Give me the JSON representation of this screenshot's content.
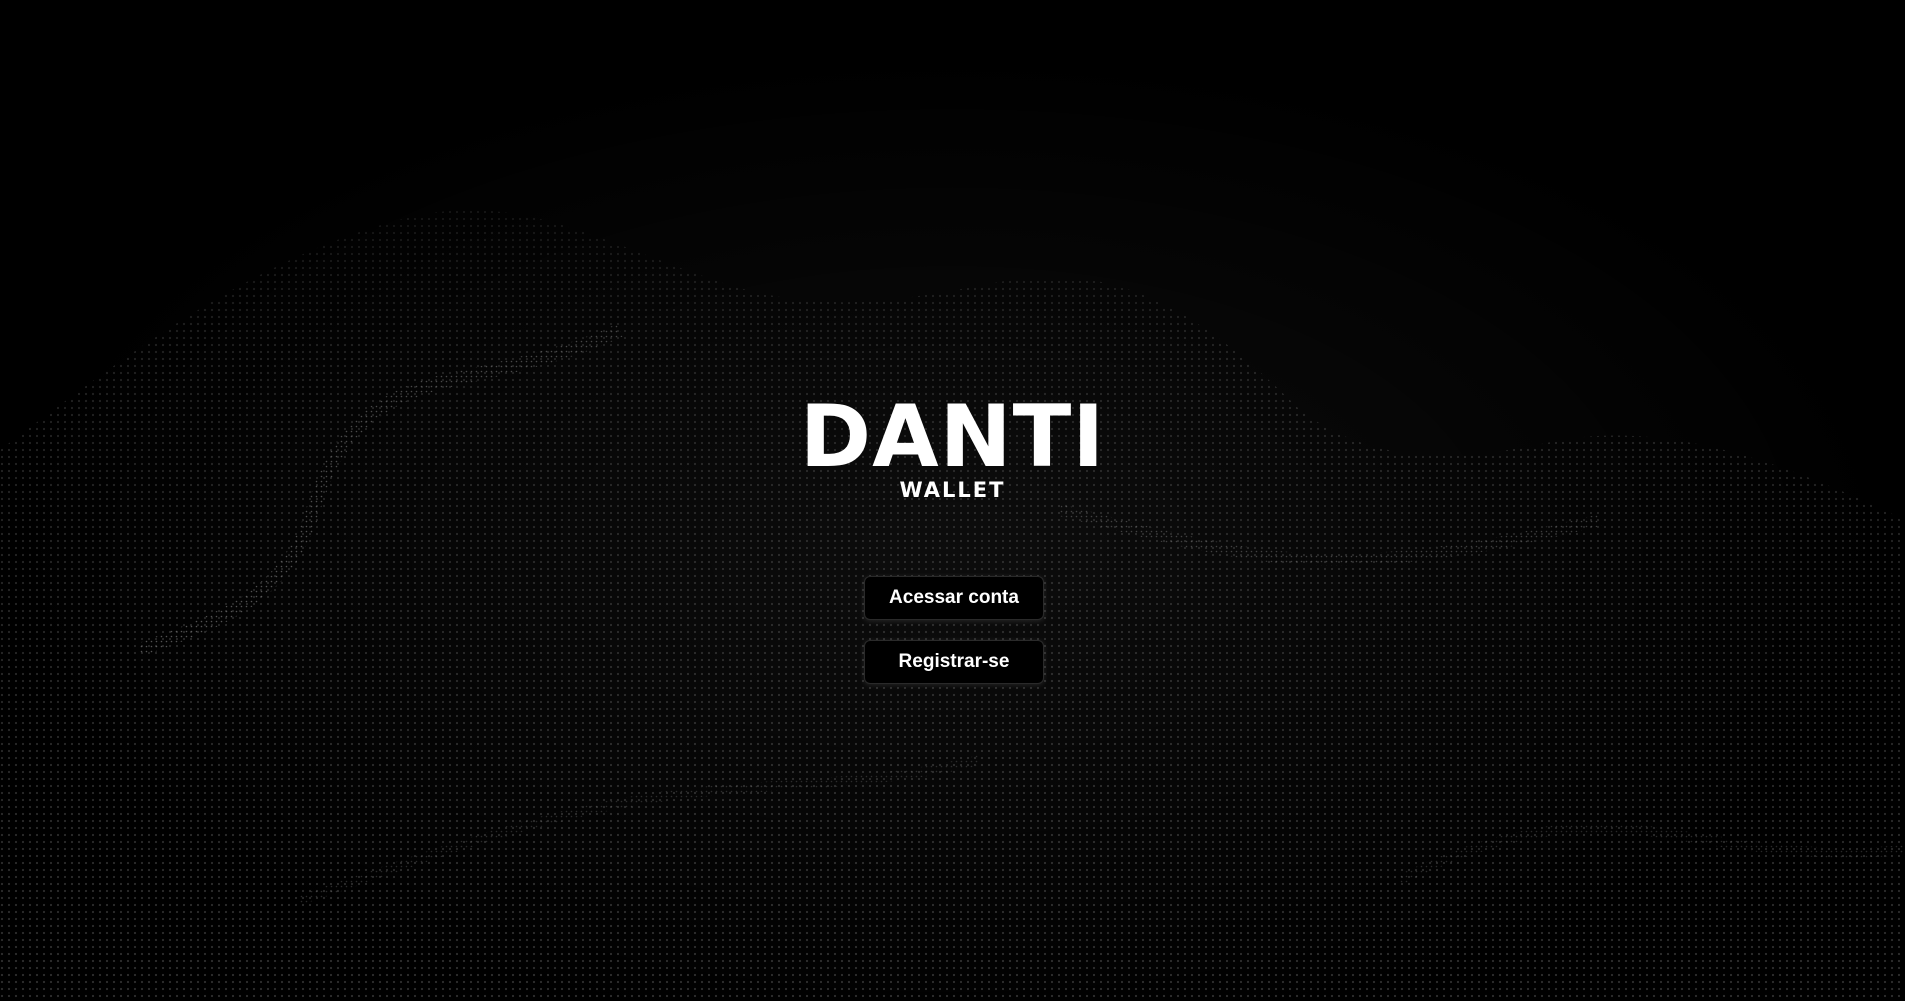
{
  "brand": {
    "title": "DANTI",
    "subtitle": "WALLET"
  },
  "actions": {
    "login_label": "Acessar conta",
    "register_label": "Registrar-se"
  },
  "colors": {
    "background": "#000000",
    "text": "#ffffff",
    "particles": "#9a9a9a"
  }
}
